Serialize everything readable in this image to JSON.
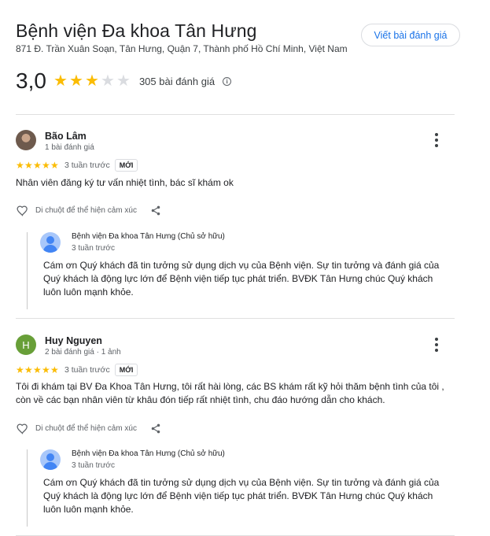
{
  "place": {
    "name": "Bệnh viện Đa khoa Tân Hưng",
    "address": "871 Đ. Trần Xuân Soạn, Tân Hưng, Quận 7, Thành phố Hồ Chí Minh, Việt Nam",
    "write_review_label": "Viết bài đánh giá",
    "rating": "3,0",
    "rating_value": 3,
    "review_count": "305 bài đánh giá"
  },
  "colors": {
    "star": "#fbbc04",
    "star_empty": "#dadce0",
    "link": "#1a73e8",
    "avatar_letter_bg": "#689f38"
  },
  "reviews": [
    {
      "name": "Bão Lâm",
      "meta": "1 bài đánh giá",
      "rating": 5,
      "time": "3 tuần trước",
      "badge": "MỚI",
      "text": "Nhân viên đăng ký tư vấn nhiệt tình, bác sĩ khám ok",
      "like_label": "Di chuột để thể hiện cảm xúc",
      "reply": {
        "owner": "Bệnh viện Đa khoa Tân Hưng (Chủ sở hữu)",
        "time": "3 tuần trước",
        "text": "Cám ơn Quý khách đã tin tưởng sử dụng dịch vụ của Bệnh viện. Sự tin tưởng và đánh giá của Quý khách là động lực lớn để Bệnh viện tiếp tục phát triển. BVĐK Tân Hưng chúc Quý khách luôn luôn mạnh khỏe."
      }
    },
    {
      "name": "Huy Nguyen",
      "avatar_letter": "H",
      "meta": "2 bài đánh giá · 1 ảnh",
      "rating": 5,
      "time": "3 tuần trước",
      "badge": "MỚI",
      "text": "Tôi đi khám tại BV Đa Khoa Tân Hưng, tôi rất hài lòng, các BS khám rất kỹ hỏi thăm bệnh tình của tôi , còn về các bạn nhân viên từ khâu đón tiếp rất nhiệt tình, chu đáo hướng dẫn cho khách.",
      "like_label": "Di chuột để thể hiện cảm xúc",
      "reply": {
        "owner": "Bệnh viện Đa khoa Tân Hưng (Chủ sở hữu)",
        "time": "3 tuần trước",
        "text": "Cám ơn Quý khách đã tin tưởng sử dụng dịch vụ của Bệnh viện. Sự tin tưởng và đánh giá của Quý khách là động lực lớn để Bệnh viện tiếp tục phát triển. BVĐK Tân Hưng chúc Quý khách luôn luôn mạnh khỏe."
      }
    }
  ]
}
